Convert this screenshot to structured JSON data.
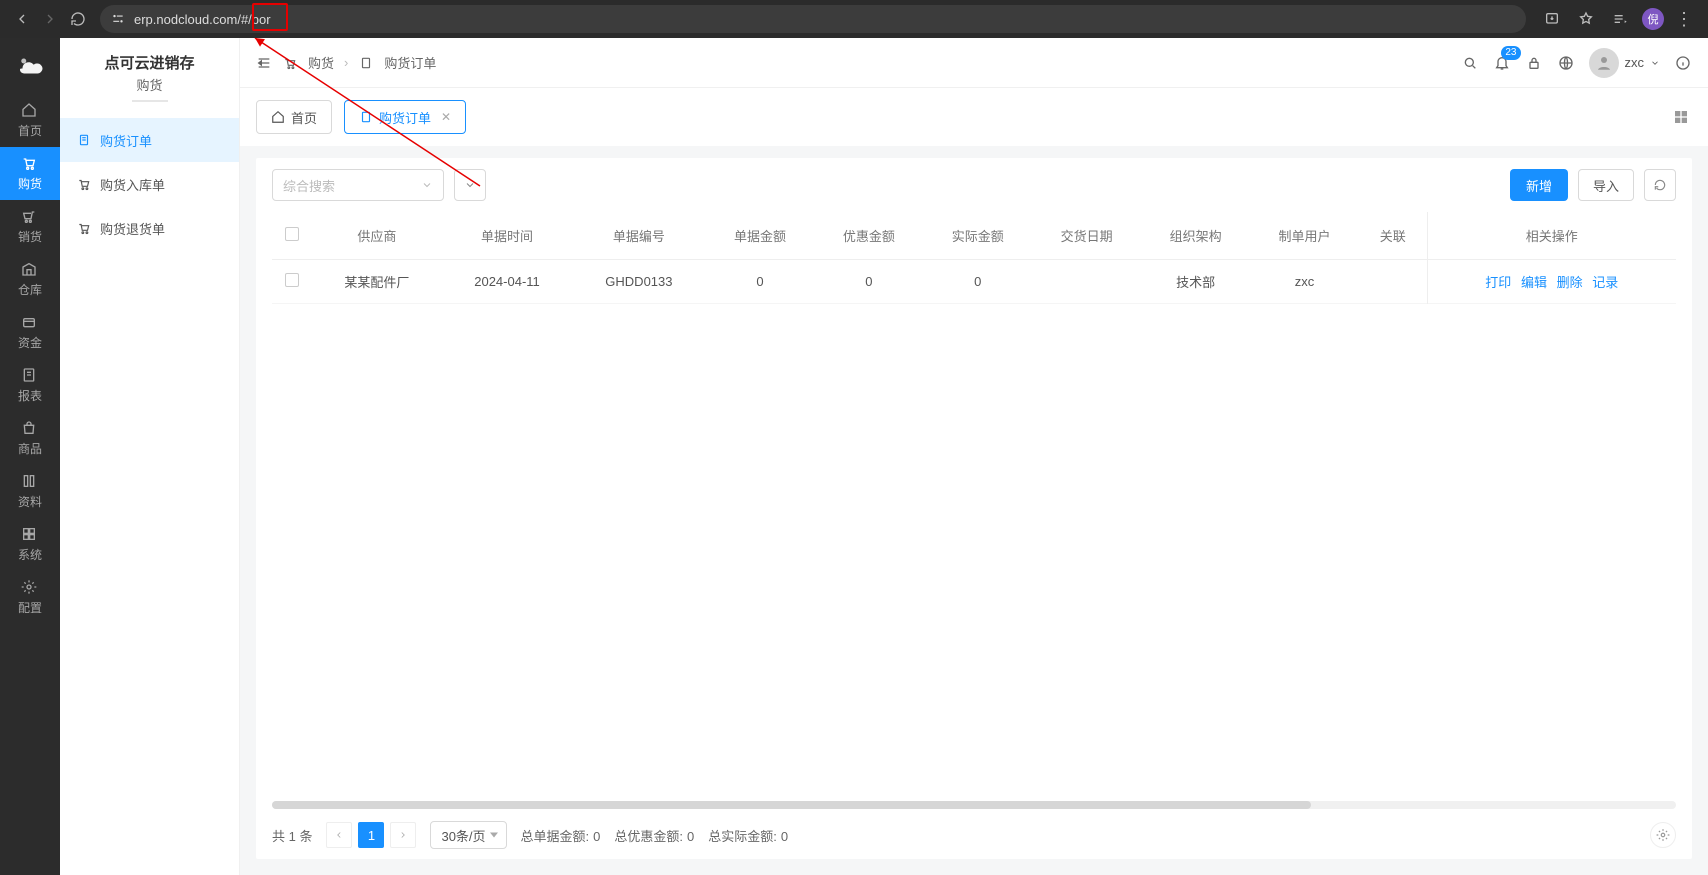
{
  "browser": {
    "url": "erp.nodcloud.com/#/bor",
    "avatar_letter": "倪"
  },
  "rail": {
    "items": [
      {
        "label": "首页"
      },
      {
        "label": "购货"
      },
      {
        "label": "销货"
      },
      {
        "label": "仓库"
      },
      {
        "label": "资金"
      },
      {
        "label": "报表"
      },
      {
        "label": "商品"
      },
      {
        "label": "资料"
      },
      {
        "label": "系统"
      },
      {
        "label": "配置"
      }
    ]
  },
  "sidebar": {
    "app_title": "点可云进销存",
    "section": "购货",
    "items": [
      {
        "label": "购货订单"
      },
      {
        "label": "购货入库单"
      },
      {
        "label": "购货退货单"
      }
    ]
  },
  "breadcrumb": {
    "root": "购货",
    "current": "购货订单"
  },
  "notifications_count": "23",
  "user": {
    "name": "zxc"
  },
  "tabs": {
    "home": "首页",
    "active": "购货订单"
  },
  "toolbar": {
    "search_placeholder": "综合搜索",
    "add": "新增",
    "import": "导入"
  },
  "table": {
    "columns": [
      "供应商",
      "单据时间",
      "单据编号",
      "单据金额",
      "优惠金额",
      "实际金额",
      "交货日期",
      "组织架构",
      "制单用户",
      "关联",
      "相关操作"
    ],
    "rows": [
      {
        "supplier": "某某配件厂",
        "date": "2024-04-11",
        "code": "GHDD0133",
        "amount": "0",
        "discount": "0",
        "actual": "0",
        "delivery": "",
        "org": "技术部",
        "maker": "zxc",
        "rel": ""
      }
    ],
    "ops": {
      "print": "打印",
      "edit": "编辑",
      "delete": "删除",
      "log": "记录"
    }
  },
  "footer": {
    "total_label": "共 1 条",
    "page": "1",
    "page_size": "30条/页",
    "sum_doc_label": "总单据金额:",
    "sum_doc_value": "0",
    "sum_discount_label": "总优惠金额:",
    "sum_discount_value": "0",
    "sum_actual_label": "总实际金额:",
    "sum_actual_value": "0"
  }
}
